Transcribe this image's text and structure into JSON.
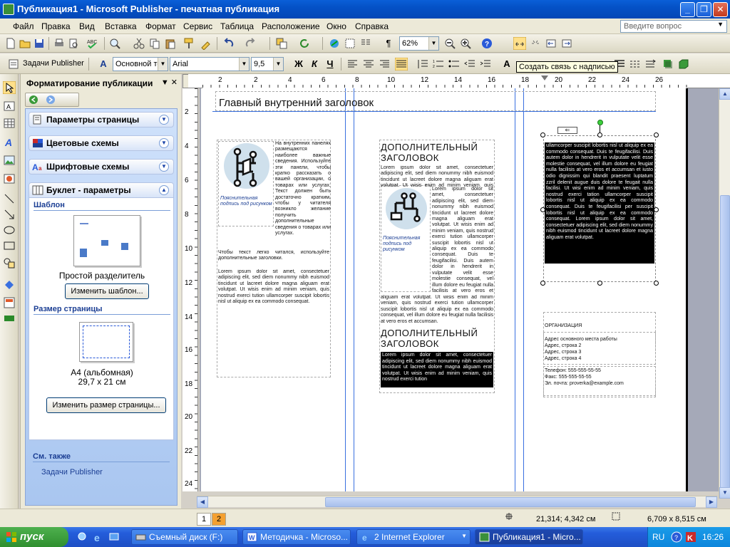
{
  "window": {
    "title": "Публикация1 - Microsoft Publisher - печатная публикация",
    "min": "_",
    "max": "❐",
    "close": "✕"
  },
  "menu": [
    "Файл",
    "Правка",
    "Вид",
    "Вставка",
    "Формат",
    "Сервис",
    "Таблица",
    "Расположение",
    "Окно",
    "Справка"
  ],
  "help_placeholder": "Введите вопрос",
  "toolbar": {
    "zoom": "62%",
    "pilcrow": "¶"
  },
  "format_bar": {
    "tasks_label": "Задачи Publisher",
    "style": "Основной текст",
    "font": "Arial",
    "size": "9,5",
    "bold": "Ж",
    "italic": "К",
    "underline": "Ч",
    "tooltip": "Создать связь с надписью"
  },
  "taskpane": {
    "title": "Форматирование публикации",
    "sections": [
      {
        "label": "Параметры страницы",
        "icon": "page-setup-icon",
        "state": "collapsed"
      },
      {
        "label": "Цветовые схемы",
        "icon": "color-scheme-icon",
        "state": "collapsed"
      },
      {
        "label": "Шрифтовые схемы",
        "icon": "font-scheme-icon",
        "state": "collapsed"
      },
      {
        "label": "Буклет - параметры",
        "icon": "brochure-icon",
        "state": "expanded"
      }
    ],
    "template_title": "Шаблон",
    "template_name": "Простой разделитель",
    "change_template": "Изменить шаблон...",
    "pagesize_title": "Размер страницы",
    "pagesize_name": "A4 (альбомная)",
    "pagesize_dims": "29,7 x 21 см",
    "change_size": "Изменить размер страницы...",
    "see_also": "См. также",
    "see_also_link": "Задачи Publisher"
  },
  "ruler_top": [
    "2",
    "2",
    "4",
    "6",
    "8",
    "10",
    "12",
    "14",
    "16",
    "18",
    "20",
    "22",
    "24",
    "26"
  ],
  "ruler_left": [
    "2",
    "4",
    "6",
    "8",
    "10",
    "12",
    "14",
    "16",
    "18",
    "20",
    "22",
    "24"
  ],
  "ruler_corner": "L",
  "page": {
    "main_heading": "Главный внутренний заголовок",
    "col1_side": "На внутренних панелях размещаются наиболее важные сведения. Используйте эти панели, чтобы кратко рассказать о вашей организации, о товарах или услугах. Текст должен быть достаточно кратким, чтобы у читателя возникло желание получить дополнительные сведения о товарах или услугах.",
    "col1_p2": "Чтобы текст легко читался, используйте дополнительные заголовки.",
    "col1_p3": "Lorem ipsum dolor sit amet, consectetuer adipiscing elit, sed diem nonummy nibh euismod tincidunt ut lacreet dolore magna aliguam erat volutpat. Ut wisis enim ad minim veniam, quis nostrud exerci tution ullamcorper suscipit lobortis nisl ut aliquip ex ea commodo consequat.",
    "col1_caption": "Пояснительная подпись под рисунком",
    "col2_heading1": "ДОПОЛНИТЕЛЬНЫЙ ЗАГОЛОВОК",
    "col2_intro": "Lorem ipsum dolor sit amet, consectetuer adipiscing elit, sed diem nonummy nibh euismod tincidunt ut lacreet dolore magna aliguam erat volutpat. Ut wisis enim ad minim veniam, quis nostrud exerci tution ullamcorper suscipit lobortis nisl ut aliquip ex ea commodo consequat. Duis te feugifacilisi. Duis autem dolor in hendrerit in vulputate velit esse molestie consequat, vel illum dolore eu feugiat nulla facilisis at vero eros et accumsan et iusto odio dignissim qui blandit praesent luptatum. Lorem ipsum dolor sit amet, consectetuer adipiscing elit, sed diem nonummy nibh euismod tincidunt ut lacreet dolore magna aliguam erat volutpat.",
    "col2_body": "aliguam erat volutpat. Ut wisis enim ad minim veniam, quis nostrud exerci tution ullamcorper suscipit lobortis nisl ut aliquip ex ea commodo consequat, vel illum dolore eu feugiat nulla facilisis at vero eros et accumsan.",
    "col2_caption": "Пояснительная подпись под рисунком",
    "col2_heading2": "ДОПОЛНИТЕЛЬНЫЙ ЗАГОЛОВОК",
    "col2_black": "Lorem ipsum dolor sit amet, consectetuer adipiscing elit, sed diem nonummy nibh euismod tincidunt ut lacreet dolore magna aliguam erat volutpat. Ut wisis enim ad minim veniam, quis nostrud exerci tution",
    "col3_black": "ullamcorper suscipit lobortis nisl ut aliquip ex ea commodo consequat. Duis te feugifacilisi. Duis autem dolor in hendrerit in vulputate velit esse molestie consequat, vel illum dolore eu feugiat nulla facilisis at vero eros et accumsan et iusto odio dignissim qui blandit praesent luptatum zzril delenit augue duis dolore te feugait nulla facilisi. Ut wisi enim ad minim veniam, quis nostrud exerci tation ullamcorper suscipit lobortis nisl ut aliquip ex ea commodo consequat. Duis te feugifacilisi per suscipit lobortis nisl ut aliquip ex ea commodo consequat. Lorem ipsum dolor sit amet, consectetuer adipiscing elit, sed diem nonummy nibh euismod tincidunt ut lacreet dolore magna aliguam erat volutpat.",
    "org_name": "ОРГАНИЗАЦИЯ",
    "addr": [
      "Адрес основного места работы",
      "Адрес, строка 2",
      "Адрес, строка 3",
      "Адрес, строка 4"
    ],
    "phone": "Телефон: 555-555-55-55",
    "fax": "Факс: 555-555-55-55",
    "email": "Эл. почта: proverka@example.com"
  },
  "status": {
    "page1": "1",
    "page2": "2",
    "position": "21,314; 4,342 см",
    "size": "6,709 x 8,515 см"
  },
  "taskbar": {
    "start": "пуск",
    "tasks": [
      "Съемный диск (F:)",
      "Методичка - Microso...",
      "2 Internet Explorer",
      "Публикация1 - Micro..."
    ],
    "lang": "RU",
    "time": "16:26"
  },
  "colors": {
    "accent": "#1c3f94",
    "guide": "#3a70e0",
    "title_blue": "#0451c6"
  }
}
